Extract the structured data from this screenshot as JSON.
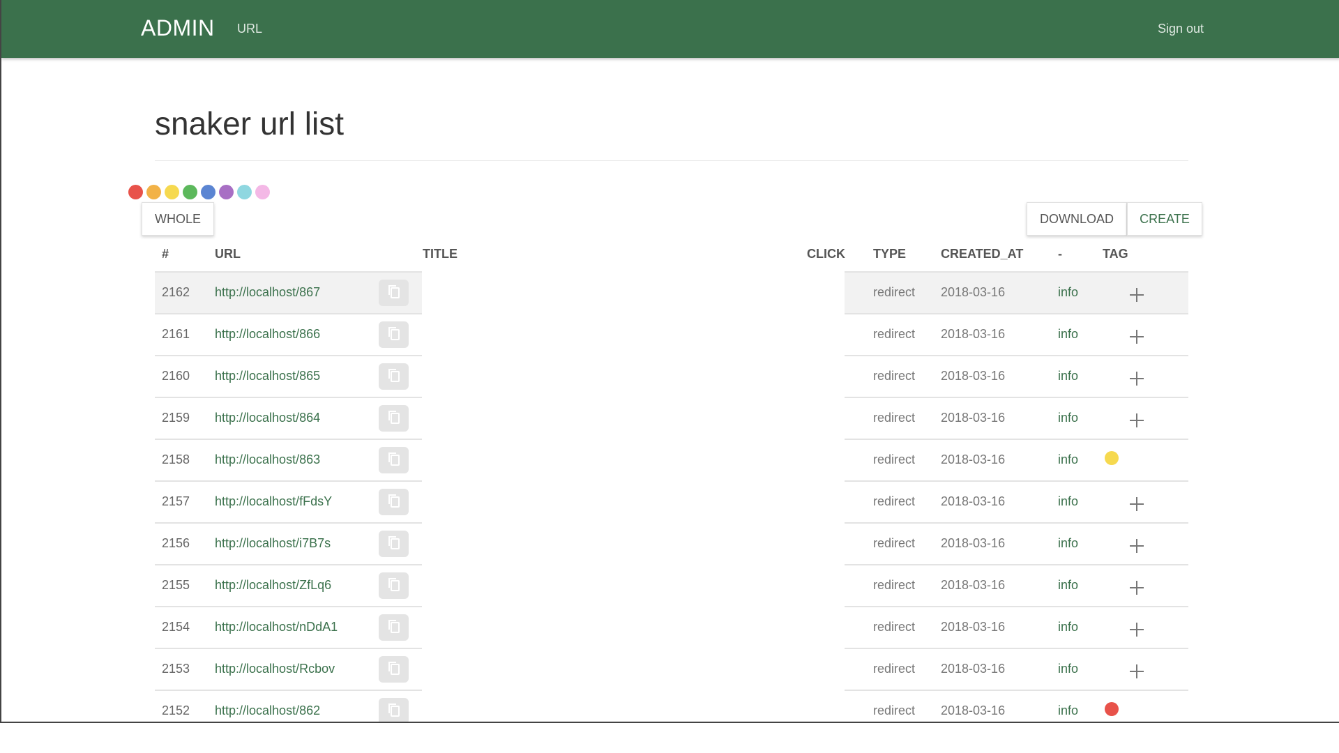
{
  "navbar": {
    "brand": "ADMIN",
    "url_link": "URL",
    "signout": "Sign out",
    "color": "#3b714c"
  },
  "page": {
    "title": "snaker url list"
  },
  "color_filter": [
    "#e8524a",
    "#f2b247",
    "#f6d94f",
    "#5cb85c",
    "#5b85d2",
    "#a86fc4",
    "#8fd7e0",
    "#f4b8e6"
  ],
  "buttons": {
    "whole": "WHOLE",
    "download": "DOWNLOAD",
    "create": "CREATE"
  },
  "table": {
    "headers": {
      "id": "#",
      "url": "URL",
      "title": "TITLE",
      "click": "CLICK",
      "type": "TYPE",
      "created_at": "CREATED_AT",
      "dash": "-",
      "tag": "TAG"
    },
    "rows": [
      {
        "id": "2162",
        "url": "http://localhost/867",
        "type": "redirect",
        "created_at": "2018-03-16",
        "info": "info",
        "tag": null,
        "hover": true
      },
      {
        "id": "2161",
        "url": "http://localhost/866",
        "type": "redirect",
        "created_at": "2018-03-16",
        "info": "info",
        "tag": null
      },
      {
        "id": "2160",
        "url": "http://localhost/865",
        "type": "redirect",
        "created_at": "2018-03-16",
        "info": "info",
        "tag": null
      },
      {
        "id": "2159",
        "url": "http://localhost/864",
        "type": "redirect",
        "created_at": "2018-03-16",
        "info": "info",
        "tag": null
      },
      {
        "id": "2158",
        "url": "http://localhost/863",
        "type": "redirect",
        "created_at": "2018-03-16",
        "info": "info",
        "tag": "#f6d94f"
      },
      {
        "id": "2157",
        "url": "http://localhost/fFdsY",
        "type": "redirect",
        "created_at": "2018-03-16",
        "info": "info",
        "tag": null
      },
      {
        "id": "2156",
        "url": "http://localhost/i7B7s",
        "type": "redirect",
        "created_at": "2018-03-16",
        "info": "info",
        "tag": null
      },
      {
        "id": "2155",
        "url": "http://localhost/ZfLq6",
        "type": "redirect",
        "created_at": "2018-03-16",
        "info": "info",
        "tag": null
      },
      {
        "id": "2154",
        "url": "http://localhost/nDdA1",
        "type": "redirect",
        "created_at": "2018-03-16",
        "info": "info",
        "tag": null
      },
      {
        "id": "2153",
        "url": "http://localhost/Rcbov",
        "type": "redirect",
        "created_at": "2018-03-16",
        "info": "info",
        "tag": null
      },
      {
        "id": "2152",
        "url": "http://localhost/862",
        "type": "redirect",
        "created_at": "2018-03-16",
        "info": "info",
        "tag": "#e8524a"
      }
    ]
  }
}
